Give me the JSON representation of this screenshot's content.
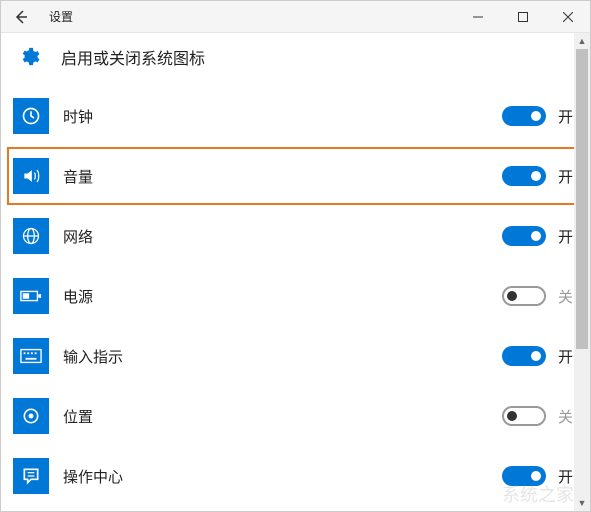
{
  "titlebar": {
    "title": "设置"
  },
  "header": {
    "page_title": "启用或关闭系统图标"
  },
  "state_labels": {
    "on": "开",
    "off": "关"
  },
  "items": [
    {
      "label": "时钟",
      "on": true,
      "icon": "clock"
    },
    {
      "label": "音量",
      "on": true,
      "icon": "volume",
      "highlighted": true
    },
    {
      "label": "网络",
      "on": true,
      "icon": "network"
    },
    {
      "label": "电源",
      "on": false,
      "icon": "power"
    },
    {
      "label": "输入指示",
      "on": true,
      "icon": "keyboard"
    },
    {
      "label": "位置",
      "on": false,
      "icon": "location"
    },
    {
      "label": "操作中心",
      "on": true,
      "icon": "action-center"
    }
  ],
  "watermark": "系统之家"
}
